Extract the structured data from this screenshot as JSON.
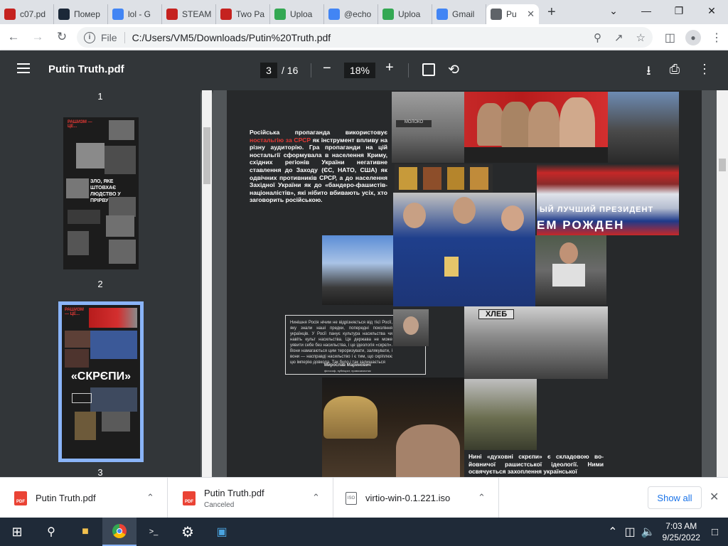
{
  "browser": {
    "tabs": [
      {
        "title": "c07.pd",
        "favicon": "pdf-icon",
        "color": "#c5221f"
      },
      {
        "title": "Помер",
        "favicon": "steam-icon",
        "color": "#1b2838"
      },
      {
        "title": "lol - G",
        "favicon": "google-icon",
        "color": "#4285f4"
      },
      {
        "title": "STEAM",
        "favicon": "pdf-icon",
        "color": "#c5221f"
      },
      {
        "title": "Two Pa",
        "favicon": "pdf-icon",
        "color": "#c5221f"
      },
      {
        "title": "Uploa",
        "favicon": "upload-icon",
        "color": "#34a853"
      },
      {
        "title": "@echo",
        "favicon": "google-icon",
        "color": "#4285f4"
      },
      {
        "title": "Uploa",
        "favicon": "upload-icon",
        "color": "#34a853"
      },
      {
        "title": "Gmail",
        "favicon": "google-icon",
        "color": "#4285f4"
      },
      {
        "title": "Pu",
        "favicon": "globe-icon",
        "color": "#5f6368"
      }
    ],
    "new_tab": "+",
    "address": {
      "scheme": "File",
      "url": "C:/Users/VM5/Downloads/Putin%20Truth.pdf"
    }
  },
  "pdf_viewer": {
    "title": "Putin Truth.pdf",
    "current_page": "3",
    "total_pages": "/ 16",
    "zoom": "18%",
    "zoom_minus": "−",
    "zoom_plus": "+",
    "thumbnails": [
      {
        "page": "1"
      },
      {
        "page": "2",
        "headline": "ЗЛО, ЯКЕ ШТОВХАЄ ЛЮДСТВО У ПРІРВУ"
      },
      {
        "page": "3",
        "headline": "«СКРЄПИ»",
        "selected": true
      }
    ]
  },
  "page_content": {
    "intro_prefix": "Російська пропаганда використовує ",
    "intro_highlight": "ностальгію за СРСР",
    "intro_rest": " як інструмент впливу на різну аудиторію. Гра пропаганди на цій ностальгії сформувала в населення Криму, східних регіонів України негативне ставлення до Заходу (ЄС, НАТО, США) як одвічних противників СРСР, а до населення Західної України як до «бандеро-фашистів-націоналістів», які нібито вбивають усіх, хто заговорить російською.",
    "quote": "Нинішня Росія нічим не відрізняється від тієї Росії, яку знали наші предки, попередні покоління українців. У Росії панує культура насильства чи навіть культ насильства. Ця держава не може уявити себе без насильства, і це ідеологія «скрєп». Вони намагаються цим тероризувати, залякувати, і вони — насправді насильство і є тим, що скріплює цю імперію довкола. Так було і так залишається",
    "quote_author": "Мирослав Маринович",
    "quote_role": "філософ, публіцист, правозахисник",
    "banner_text_1": "ЫЙ ЛУЧШИЙ ПРЕЗИДЕНТ",
    "banner_text_2": "ЕМ РОЖДЕН",
    "store_sign": "ХЛЕБ",
    "moloko_sign": "МОЛОКО",
    "bottom_text": "Нині «духовні скрєпи» є складовою во-йовничої рашистської ідеології. Ними освячується захоплення української"
  },
  "downloads": [
    {
      "name": "Putin Truth.pdf",
      "status": "",
      "type": "pdf"
    },
    {
      "name": "Putin Truth.pdf",
      "status": "Canceled",
      "type": "pdf"
    },
    {
      "name": "virtio-win-0.1.221.iso",
      "status": "",
      "type": "iso"
    }
  ],
  "downloads_show_all": "Show all",
  "taskbar": {
    "time": "7:03 AM",
    "date": "9/25/2022"
  }
}
